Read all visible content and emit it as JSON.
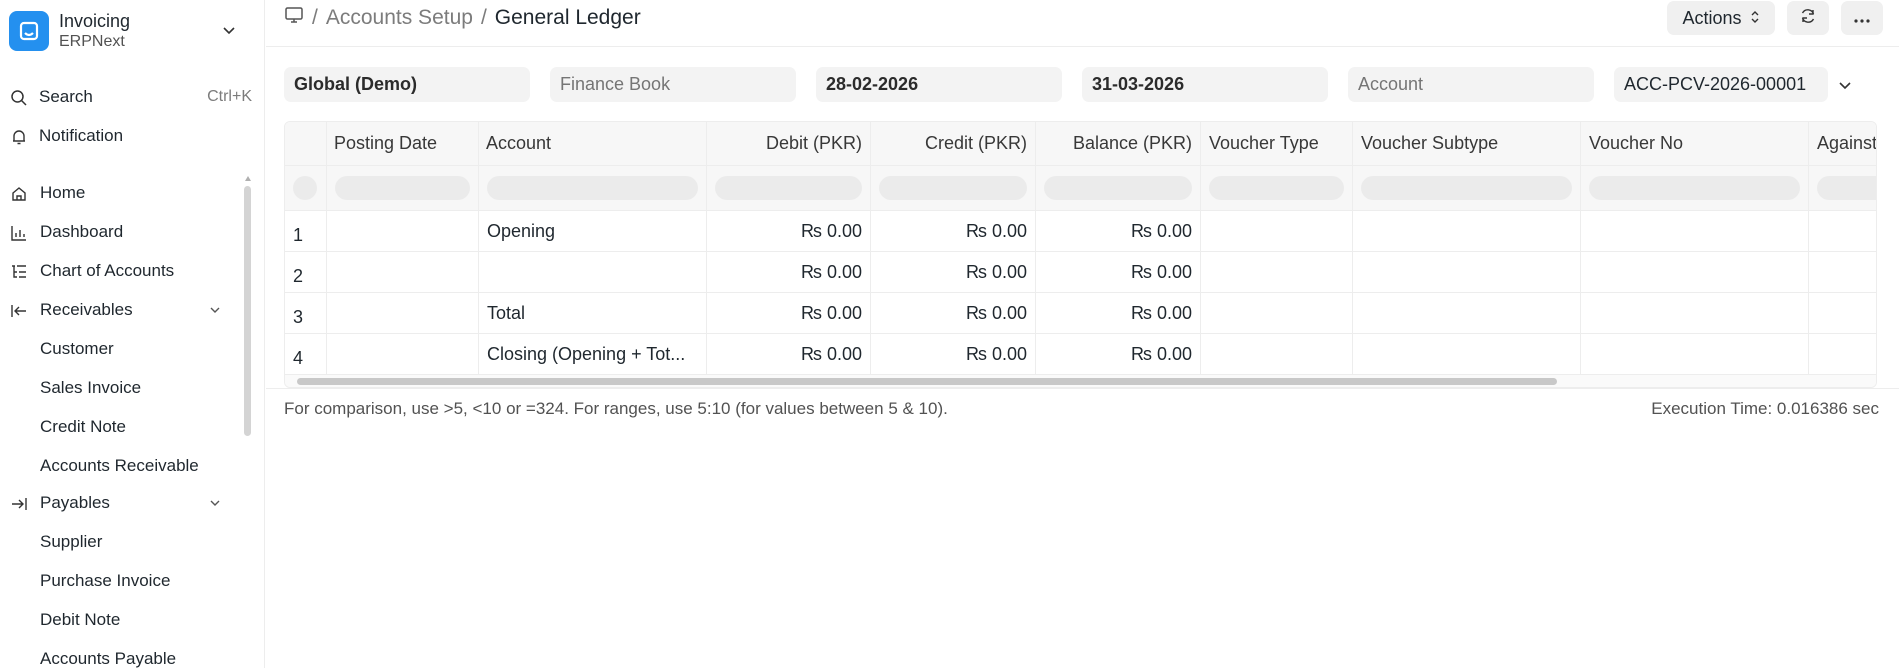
{
  "app": {
    "title": "Invoicing",
    "subtitle": "ERPNext"
  },
  "sidebar": {
    "search": {
      "label": "Search",
      "shortcut": "Ctrl+K"
    },
    "notification": "Notification",
    "items": [
      {
        "label": "Home",
        "icon": "home-icon"
      },
      {
        "label": "Dashboard",
        "icon": "bar-chart-icon"
      },
      {
        "label": "Chart of Accounts",
        "icon": "list-tree-icon"
      },
      {
        "label": "Receivables",
        "icon": "arrow-left-bar-icon"
      },
      {
        "label": "Customer"
      },
      {
        "label": "Sales Invoice"
      },
      {
        "label": "Credit Note"
      },
      {
        "label": "Accounts Receivable"
      },
      {
        "label": "Payables",
        "icon": "arrow-right-bar-icon"
      },
      {
        "label": "Supplier"
      },
      {
        "label": "Purchase Invoice"
      },
      {
        "label": "Debit Note"
      },
      {
        "label": "Accounts Payable"
      }
    ]
  },
  "header": {
    "breadcrumb": [
      "Accounts Setup",
      "General Ledger"
    ],
    "actions_label": "Actions"
  },
  "filters": {
    "company": "Global (Demo)",
    "finance_book_placeholder": "Finance Book",
    "from_date": "28-02-2026",
    "to_date": "31-03-2026",
    "account_placeholder": "Account",
    "voucher_no": "ACC-PCV-2026-00001"
  },
  "table": {
    "columns": [
      "Posting Date",
      "Account",
      "Debit (PKR)",
      "Credit (PKR)",
      "Balance (PKR)",
      "Voucher Type",
      "Voucher Subtype",
      "Voucher No",
      "Against"
    ],
    "rows": [
      {
        "n": "1",
        "posting_date": "",
        "account": "Opening",
        "debit": "₨ 0.00",
        "credit": "₨ 0.00",
        "balance": "₨ 0.00"
      },
      {
        "n": "2",
        "posting_date": "",
        "account": "",
        "debit": "₨ 0.00",
        "credit": "₨ 0.00",
        "balance": "₨ 0.00"
      },
      {
        "n": "3",
        "posting_date": "",
        "account": "Total",
        "debit": "₨ 0.00",
        "credit": "₨ 0.00",
        "balance": "₨ 0.00"
      },
      {
        "n": "4",
        "posting_date": "",
        "account": "Closing (Opening + Tot...",
        "debit": "₨ 0.00",
        "credit": "₨ 0.00",
        "balance": "₨ 0.00"
      }
    ]
  },
  "footer": {
    "help": "For comparison, use >5, <10 or =324. For ranges, use 5:10 (for values between 5 & 10).",
    "execution": "Execution Time: 0.016386 sec"
  },
  "colors": {
    "accent": "#2490ef",
    "border": "#ededed",
    "field_bg": "#f3f3f3"
  }
}
